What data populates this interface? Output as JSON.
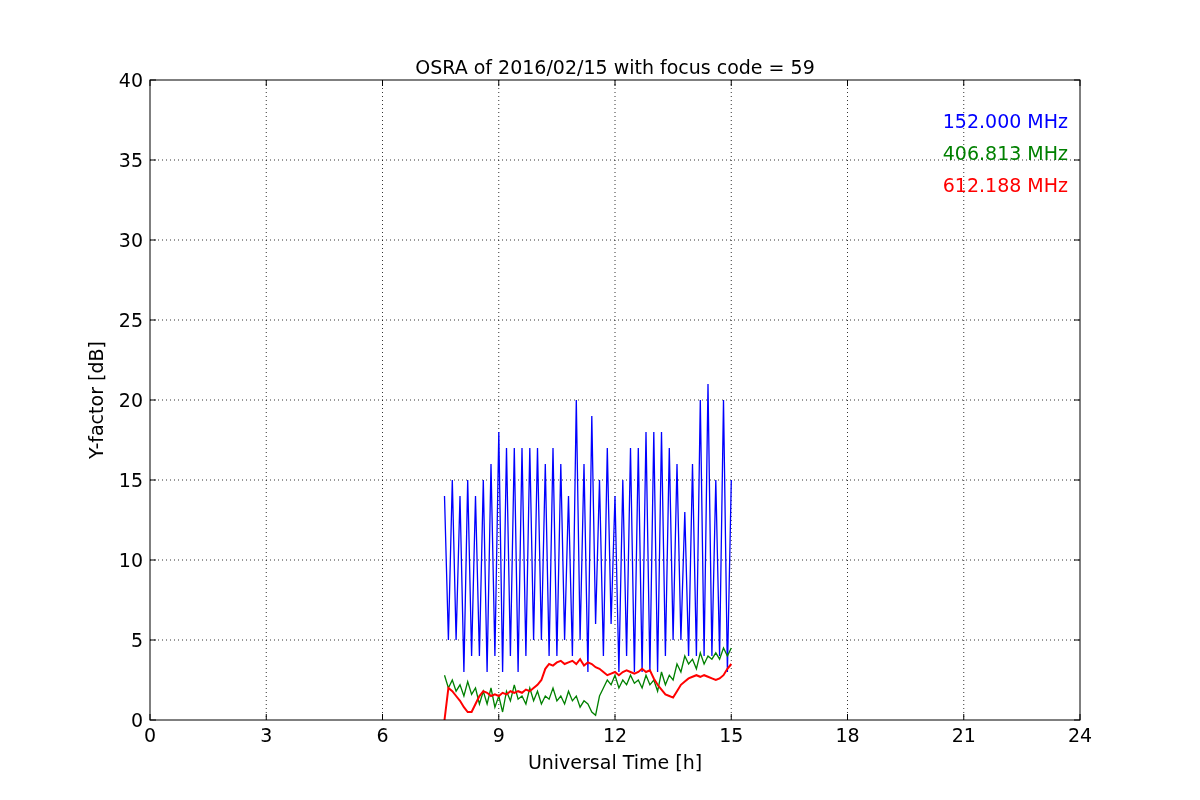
{
  "chart_data": {
    "type": "line",
    "grid": true,
    "title": "OSRA of 2016/02/15 with focus code = 59",
    "xlabel": "Universal Time [h]",
    "ylabel": "Y-factor [dB]",
    "xlim": [
      0,
      24
    ],
    "ylim": [
      0,
      40
    ],
    "xticks": [
      0,
      3,
      6,
      9,
      12,
      15,
      18,
      21,
      24
    ],
    "yticks": [
      0,
      5,
      10,
      15,
      20,
      25,
      30,
      35,
      40
    ],
    "x": [
      7.6,
      7.7,
      7.8,
      7.9,
      8.0,
      8.1,
      8.2,
      8.3,
      8.4,
      8.5,
      8.6,
      8.7,
      8.8,
      8.9,
      9.0,
      9.1,
      9.2,
      9.3,
      9.4,
      9.5,
      9.6,
      9.7,
      9.8,
      9.9,
      10.0,
      10.1,
      10.2,
      10.3,
      10.4,
      10.5,
      10.6,
      10.7,
      10.8,
      10.9,
      11.0,
      11.1,
      11.2,
      11.3,
      11.4,
      11.5,
      11.6,
      11.7,
      11.8,
      11.9,
      12.0,
      12.1,
      12.2,
      12.3,
      12.4,
      12.5,
      12.6,
      12.7,
      12.8,
      12.9,
      13.0,
      13.1,
      13.2,
      13.3,
      13.4,
      13.5,
      13.6,
      13.7,
      13.8,
      13.9,
      14.0,
      14.1,
      14.2,
      14.3,
      14.4,
      14.5,
      14.6,
      14.7,
      14.8,
      14.9,
      15.0
    ],
    "series": [
      {
        "name": "152.000 MHz",
        "color": "#0000ff",
        "values": [
          14,
          5,
          15,
          5,
          14,
          3,
          15,
          4,
          14,
          4,
          15,
          3,
          16,
          4,
          18,
          3,
          17,
          4,
          17,
          3,
          17,
          4,
          17,
          5,
          17,
          5,
          16,
          4,
          17,
          4,
          16,
          5,
          14,
          4,
          20,
          5,
          16,
          3,
          19,
          6,
          15,
          4,
          17,
          6,
          14,
          3,
          15,
          4,
          17,
          3,
          17,
          3,
          18,
          3,
          18,
          3,
          18,
          4,
          17,
          5,
          16,
          5,
          13,
          4,
          16,
          4,
          20,
          4,
          21,
          4,
          15,
          4,
          20,
          3,
          15
        ]
      },
      {
        "name": "406.813 MHz",
        "color": "#008000",
        "values": [
          2.8,
          2,
          2.5,
          1.8,
          2.2,
          1.5,
          2.4,
          1.6,
          2,
          1,
          1.8,
          1,
          2,
          0.8,
          1.5,
          0.5,
          1.8,
          1.2,
          2.2,
          1.3,
          1.5,
          1,
          2,
          1.2,
          1.8,
          1,
          1.5,
          1.3,
          2,
          1.2,
          1.5,
          1,
          1.8,
          1.2,
          1.5,
          0.8,
          1.2,
          1,
          0.5,
          0.3,
          1.5,
          2,
          2.5,
          2.2,
          2.8,
          2,
          2.5,
          2.2,
          2.8,
          2.3,
          2.5,
          2,
          2.8,
          2.2,
          2.5,
          1.8,
          3,
          2.2,
          2.8,
          2.5,
          3.5,
          3,
          4,
          3.5,
          3.8,
          3.2,
          4.2,
          3.5,
          4,
          3.8,
          4.2,
          3.8,
          4.5,
          4,
          4.5
        ]
      },
      {
        "name": "612.188 MHz",
        "color": "#ff0000",
        "values": [
          0,
          2,
          1.8,
          1.5,
          1.2,
          0.8,
          0.5,
          0.5,
          1,
          1.5,
          1.8,
          1.7,
          1.5,
          1.6,
          1.5,
          1.7,
          1.6,
          1.8,
          1.7,
          1.8,
          1.7,
          1.9,
          1.8,
          2,
          2.2,
          2.5,
          3.2,
          3.5,
          3.4,
          3.6,
          3.7,
          3.5,
          3.6,
          3.7,
          3.5,
          3.8,
          3.4,
          3.6,
          3.5,
          3.3,
          3.2,
          3,
          2.8,
          2.9,
          3,
          2.8,
          3,
          3.1,
          3,
          2.9,
          3,
          3.2,
          3,
          3.1,
          2.6,
          2.2,
          1.9,
          1.6,
          1.5,
          1.4,
          1.8,
          2.2,
          2.4,
          2.6,
          2.7,
          2.8,
          2.7,
          2.8,
          2.7,
          2.6,
          2.5,
          2.6,
          2.8,
          3.2,
          3.5
        ]
      }
    ]
  }
}
